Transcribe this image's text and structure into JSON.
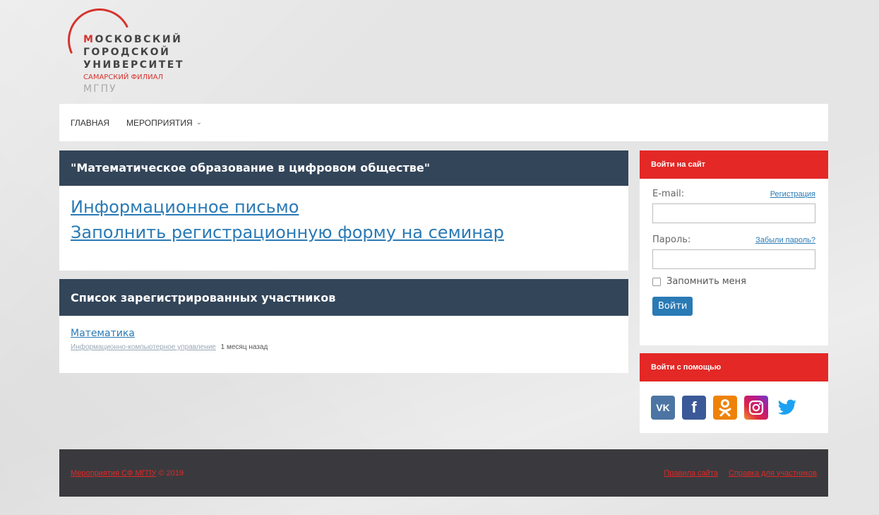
{
  "logo": {
    "line1_first": "М",
    "line1_rest": "ОСКОВСКИЙ",
    "line2": "ГОРОДСКОЙ",
    "line3": "УНИВЕРСИТЕТ",
    "line4": "САМАРСКИЙ ФИЛИАЛ",
    "line5": "МГПУ"
  },
  "nav": {
    "items": [
      {
        "label": "ГЛАВНАЯ"
      },
      {
        "label": "МЕРОПРИЯТИЯ",
        "icon": "chevron-down-icon"
      }
    ]
  },
  "main": {
    "event_title": "\"Математическое образование в цифровом обществе\"",
    "links": [
      {
        "label": "Информационное письмо"
      },
      {
        "label": "Заполнить регистрационную форму на семинар"
      }
    ],
    "participants_title": "Список зарегистрированных участников",
    "participants": [
      {
        "title": "Математика",
        "category": "Информационно-компьютерное управление",
        "time": "1 месяц назад"
      }
    ]
  },
  "login": {
    "header": "Войти на сайт",
    "email_label": "E-mail:",
    "register_link": "Регистрация",
    "password_label": "Пароль:",
    "forgot_link": "Забыли пароль?",
    "remember_label": "Запомнить меня",
    "submit_label": "Войти"
  },
  "social": {
    "header": "Войти с помощью",
    "icons": [
      {
        "name": "vk-icon",
        "glyph": "VK",
        "color": "#4c75a3"
      },
      {
        "name": "facebook-icon",
        "glyph": "f",
        "color": "#3b5998"
      },
      {
        "name": "odnoklassniki-icon",
        "glyph": "ОК",
        "color": "#ee8208"
      },
      {
        "name": "instagram-icon",
        "glyph": "",
        "color": "#dc2743"
      },
      {
        "name": "twitter-icon",
        "glyph": "",
        "color": "#1da1f2"
      }
    ]
  },
  "footer": {
    "site_link": "Мероприятия СФ МГПУ",
    "copyright": " © 2019",
    "rules_link": "Правила сайта",
    "help_link": "Справка для участников"
  },
  "colors": {
    "header_bg": "#334559",
    "sidebar_header": "#e32826",
    "link": "#2a7ab5",
    "footer_bg": "#3a3a3e"
  }
}
